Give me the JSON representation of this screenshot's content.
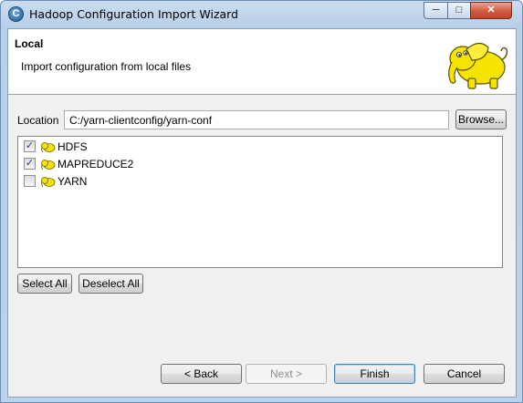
{
  "window": {
    "title": "Hadoop Configuration Import Wizard",
    "controls": {
      "minimize": "─",
      "maximize": "□",
      "close": "✕"
    }
  },
  "header": {
    "title": "Local",
    "subtitle": "Import configuration from local files",
    "logo_icon": "hadoop-elephant"
  },
  "location": {
    "label": "Location",
    "value": "C:/yarn-clientconfig/yarn-conf",
    "browse_label": "Browse..."
  },
  "services": [
    {
      "label": "HDFS",
      "checked": true
    },
    {
      "label": "MAPREDUCE2",
      "checked": true
    },
    {
      "label": "YARN",
      "checked": false
    }
  ],
  "selection": {
    "select_all": "Select All",
    "deselect_all": "Deselect All"
  },
  "footer": {
    "back": "< Back",
    "next": "Next >",
    "finish": "Finish",
    "cancel": "Cancel"
  },
  "colors": {
    "accent": "#3c7fb1",
    "elephant": "#f5e400"
  }
}
